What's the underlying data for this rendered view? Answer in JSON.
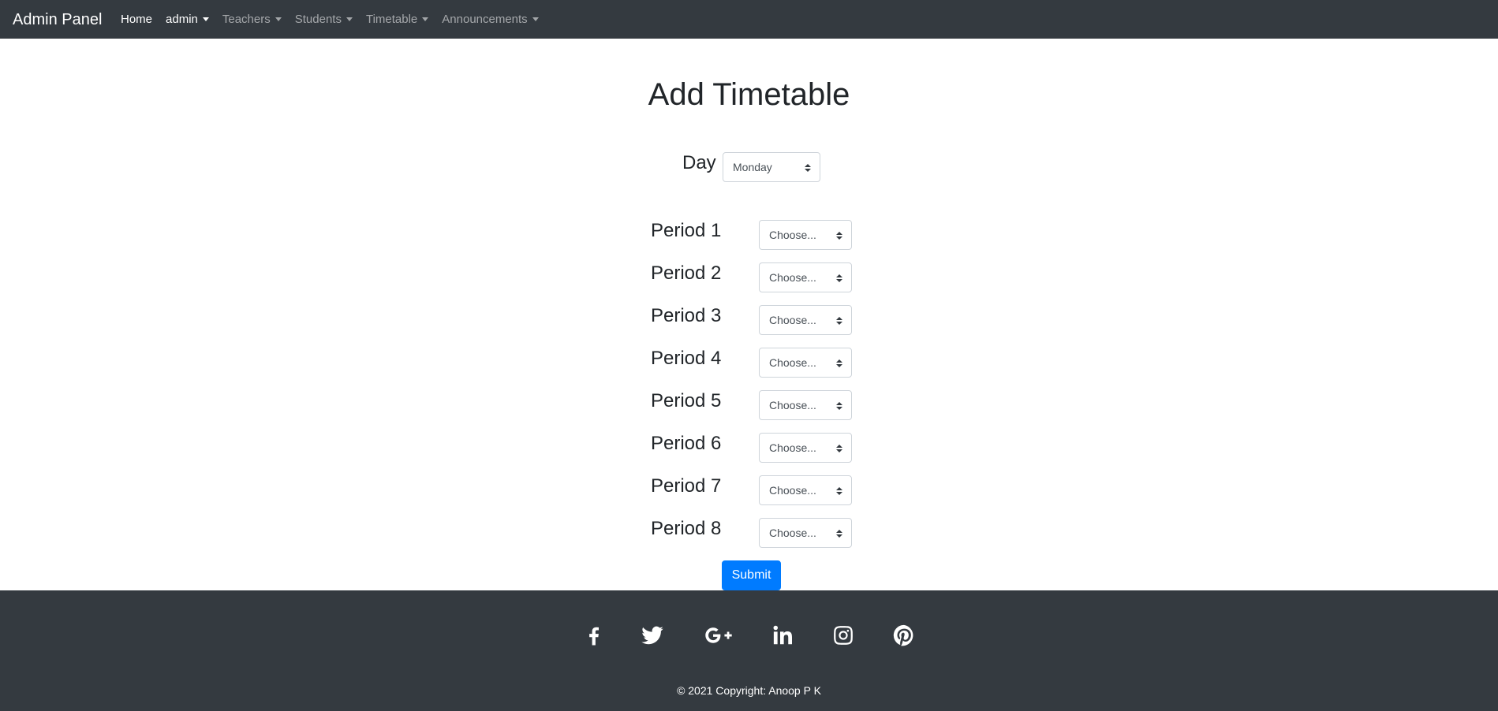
{
  "navbar": {
    "brand": "Admin Panel",
    "items": [
      {
        "label": "Home",
        "dropdown": false,
        "active": true
      },
      {
        "label": "admin",
        "dropdown": true,
        "active": true
      },
      {
        "label": "Teachers",
        "dropdown": true,
        "active": false
      },
      {
        "label": "Students",
        "dropdown": true,
        "active": false
      },
      {
        "label": "Timetable",
        "dropdown": true,
        "active": false
      },
      {
        "label": "Announcements",
        "dropdown": true,
        "active": false
      }
    ]
  },
  "form": {
    "title": "Add Timetable",
    "day_label": "Day",
    "day_value": "Monday",
    "periods": [
      {
        "label": "Period 1",
        "value": "Choose..."
      },
      {
        "label": "Period 2",
        "value": "Choose..."
      },
      {
        "label": "Period 3",
        "value": "Choose..."
      },
      {
        "label": "Period 4",
        "value": "Choose..."
      },
      {
        "label": "Period 5",
        "value": "Choose..."
      },
      {
        "label": "Period 6",
        "value": "Choose..."
      },
      {
        "label": "Period 7",
        "value": "Choose..."
      },
      {
        "label": "Period 8",
        "value": "Choose..."
      }
    ],
    "submit_label": "Submit"
  },
  "footer": {
    "social_icons": [
      "facebook-icon",
      "twitter-icon",
      "google-plus-icon",
      "linkedin-icon",
      "instagram-icon",
      "pinterest-icon"
    ],
    "copyright": "© 2021 Copyright: Anoop P K"
  },
  "colors": {
    "navbar_bg": "#343a40",
    "primary": "#007bff",
    "footer_bg": "#343a40"
  }
}
